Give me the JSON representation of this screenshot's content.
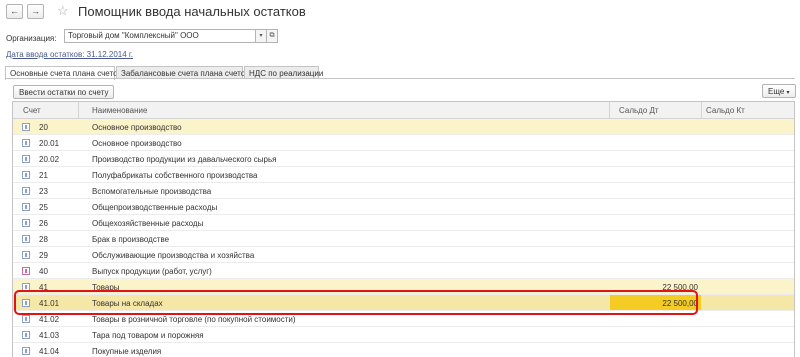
{
  "window": {
    "title": "Помощник ввода начальных остатков",
    "nav": {
      "back_icon": "arrow-left-icon",
      "forward_icon": "arrow-right-icon",
      "back": "←",
      "forward": "→",
      "favorite": "☆"
    }
  },
  "organization": {
    "label": "Организация:",
    "value": "Торговый дом \"Комплексный\" ООО",
    "dropdown_glyph": "▾",
    "open_glyph": "⧉"
  },
  "date_link": "Дата ввода остатков: 31.12.2014 г.",
  "tabs": [
    {
      "label": "Основные счета плана счетов",
      "active": true
    },
    {
      "label": "Забалансовые счета плана счетов",
      "active": false
    },
    {
      "label": "НДС по реализации",
      "active": false
    }
  ],
  "toolbar": {
    "enter_balances": "Ввести остатки по счету",
    "more": "Еще",
    "more_arrow": "▾"
  },
  "table": {
    "columns": [
      "Счет",
      "Наименование",
      "Сальдо Дт",
      "Сальдо Кт"
    ],
    "rows": [
      {
        "account": "20",
        "name": "Основное производство",
        "debit": "",
        "credit": "",
        "icon": "account-icon",
        "state": "highlight"
      },
      {
        "account": "20.01",
        "name": "Основное производство",
        "debit": "",
        "credit": "",
        "icon": "account-icon",
        "state": ""
      },
      {
        "account": "20.02",
        "name": "Производство продукции из давальческого сырья",
        "debit": "",
        "credit": "",
        "icon": "account-icon",
        "state": ""
      },
      {
        "account": "21",
        "name": "Полуфабрикаты собственного производства",
        "debit": "",
        "credit": "",
        "icon": "account-icon",
        "state": ""
      },
      {
        "account": "23",
        "name": "Вспомогательные производства",
        "debit": "",
        "credit": "",
        "icon": "account-icon",
        "state": ""
      },
      {
        "account": "25",
        "name": "Общепроизводственные расходы",
        "debit": "",
        "credit": "",
        "icon": "account-icon",
        "state": ""
      },
      {
        "account": "26",
        "name": "Общехозяйственные расходы",
        "debit": "",
        "credit": "",
        "icon": "account-icon",
        "state": ""
      },
      {
        "account": "28",
        "name": "Брак в производстве",
        "debit": "",
        "credit": "",
        "icon": "account-icon",
        "state": ""
      },
      {
        "account": "29",
        "name": "Обслуживающие производства и хозяйства",
        "debit": "",
        "credit": "",
        "icon": "account-icon",
        "state": ""
      },
      {
        "account": "40",
        "name": "Выпуск продукции (работ, услуг)",
        "debit": "",
        "credit": "",
        "icon": "account-alt-icon",
        "state": ""
      },
      {
        "account": "41",
        "name": "Товары",
        "debit": "22 500,00",
        "credit": "",
        "icon": "account-icon",
        "state": "highlight"
      },
      {
        "account": "41.01",
        "name": "Товары на складах",
        "debit": "22 500,00",
        "credit": "",
        "icon": "account-icon",
        "state": "selected"
      },
      {
        "account": "41.02",
        "name": "Товары в розничной торговле (по покупной стоимости)",
        "debit": "",
        "credit": "",
        "icon": "account-icon",
        "state": ""
      },
      {
        "account": "41.03",
        "name": "Тара под товаром и порожняя",
        "debit": "",
        "credit": "",
        "icon": "account-icon",
        "state": ""
      },
      {
        "account": "41.04",
        "name": "Покупные изделия",
        "debit": "",
        "credit": "",
        "icon": "account-icon",
        "state": ""
      }
    ]
  },
  "colors": {
    "row_highlight": "#fbf3c9",
    "row_selected": "#f5e7a6",
    "cell_selected": "#f5cc24",
    "annotation_circle": "#e01414",
    "link": "#4a5a8a"
  }
}
